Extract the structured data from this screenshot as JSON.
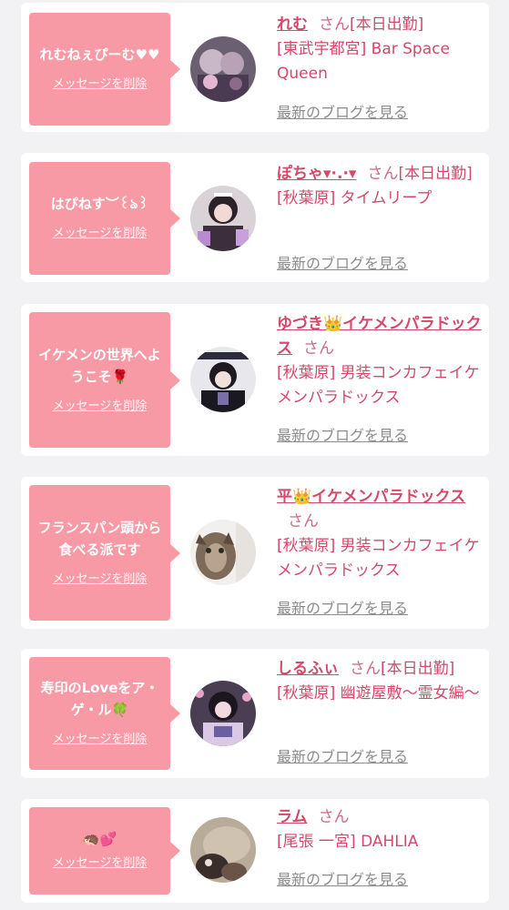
{
  "common": {
    "delete_label": "メッセージを削除",
    "blog_label": "最新のブログを見る",
    "honorific": "さん"
  },
  "colors": {
    "background": "#f2f2f4",
    "bubble": "#f89aa6",
    "accent": "#d6486a",
    "blog_link": "#8c8c8c"
  },
  "cards": [
    {
      "message": "れむねぇぴーむ♥♥",
      "name": "れむ",
      "status": "[本日出勤]",
      "shop": "[東武宇都宮] Bar Space Queen",
      "avatar": "person-photo-purple"
    },
    {
      "message": "はぴねす︶꒰ঌ꒱",
      "name": "ぽちゃ▾·.·▾",
      "status": "[本日出勤]",
      "shop": "[秋葉原] タイムリープ",
      "avatar": "person-photo-maid"
    },
    {
      "message": "イケメンの世界へようこそ🌹",
      "name": "ゆづき👑イケメンパラドックス",
      "status": "",
      "shop": "[秋葉原] 男装コンカフェイケメンパラドックス",
      "avatar": "person-photo-dark"
    },
    {
      "message": "フランスパン頭から食べる派です",
      "name": "平👑イケメンパラドックス",
      "status": "",
      "shop": "[秋葉原] 男装コンカフェイケメンパラドックス",
      "avatar": "cat-photo"
    },
    {
      "message": "寿印のLoveをア・ゲ・ル🍀",
      "name": "しるふぃ",
      "status": "[本日出勤]",
      "shop": "[秋葉原] 幽遊屋敷〜霊女編〜",
      "avatar": "person-photo-pink"
    },
    {
      "message": "🦔💕",
      "name": "ラム",
      "status": "",
      "shop": "[尾張 一宮] DAHLIA",
      "avatar": "photo-blurred"
    }
  ]
}
